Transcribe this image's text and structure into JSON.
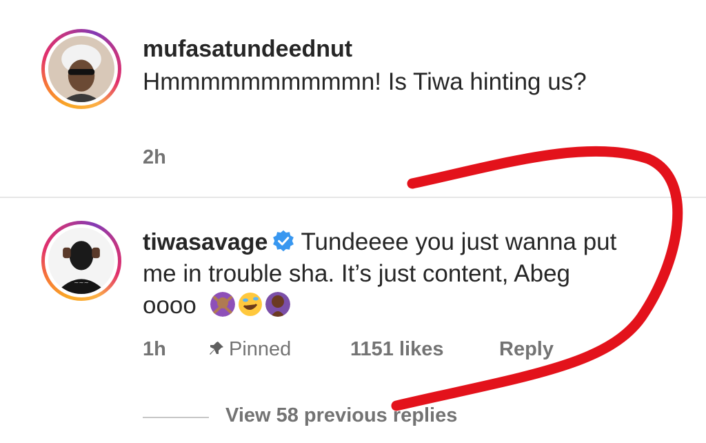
{
  "comments": [
    {
      "username": "mufasatundeednut",
      "text": "Hmmmmmmmmmmn! Is Tiwa hinting us?",
      "time": "2h"
    },
    {
      "username": "tiwasavage",
      "verified": true,
      "text": "Tundeeee you just wanna put me in trouble sha. It’s just content, Abeg oooo",
      "emojis": [
        "woman-gesturing-no",
        "rolling-on-floor-laughing",
        "woman-facepalming"
      ],
      "time": "1h",
      "pinned_label": "Pinned",
      "likes": "1151 likes",
      "reply_label": "Reply"
    }
  ],
  "view_replies": "View 58 previous replies",
  "colors": {
    "text": "#262626",
    "meta": "#737373",
    "verified": "#3897f0",
    "annotation": "#e3121b",
    "divider": "#e6e6e6"
  }
}
